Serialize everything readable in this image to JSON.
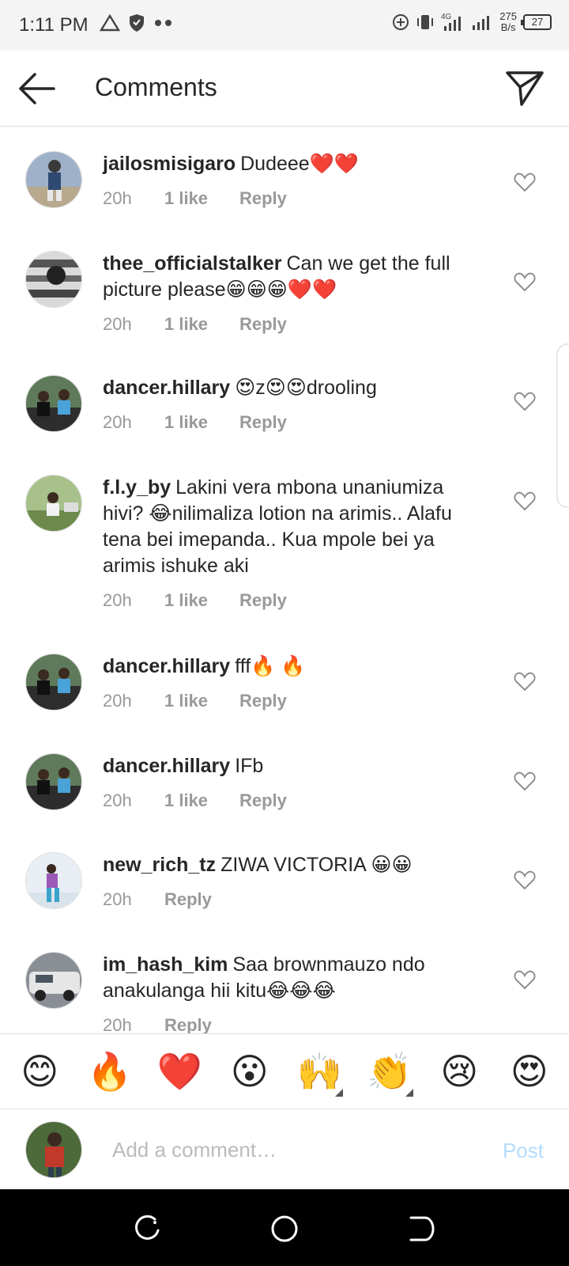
{
  "status_bar": {
    "time": "1:11 PM",
    "network": "4G",
    "speed_value": "275",
    "speed_unit": "B/s",
    "battery": "27"
  },
  "header": {
    "title": "Comments",
    "back_icon": "arrow-left-icon",
    "send_icon": "paper-plane-icon"
  },
  "comments": [
    {
      "username": "jailosmisigaro",
      "text": "Dudeee❤️❤️",
      "time": "20h",
      "likes": "1 like",
      "reply": "Reply"
    },
    {
      "username": "thee_officialstalker",
      "text": "Can we get the full picture please😁😁😁❤️❤️",
      "time": "20h",
      "likes": "1 like",
      "reply": "Reply"
    },
    {
      "username": "dancer.hillary",
      "text": "😍z😍😍drooling",
      "time": "20h",
      "likes": "1 like",
      "reply": "Reply"
    },
    {
      "username": "f.l.y_by",
      "text": "Lakini vera mbona unaniumiza hivi? 😂nilimaliza lotion na arimis.. Alafu tena bei imepanda.. Kua mpole bei ya arimis ishuke aki",
      "time": "20h",
      "likes": "1 like",
      "reply": "Reply"
    },
    {
      "username": "dancer.hillary",
      "text": "fff🔥 🔥",
      "time": "20h",
      "likes": "1 like",
      "reply": "Reply"
    },
    {
      "username": "dancer.hillary",
      "text": "IFb",
      "time": "20h",
      "likes": "1 like",
      "reply": "Reply"
    },
    {
      "username": "new_rich_tz",
      "text": "ZIWA VICTORIA 😀😀",
      "time": "20h",
      "likes": "",
      "reply": "Reply"
    },
    {
      "username": "im_hash_kim",
      "text": "Saa brownmauzo ndo anakulanga hii kitu😂😂😂",
      "time": "20h",
      "likes": "",
      "reply": "Reply"
    }
  ],
  "emoji_bar": [
    "😊",
    "🔥",
    "❤️",
    "😮",
    "🙌",
    "👏",
    "😢",
    "😍"
  ],
  "compose": {
    "placeholder": "Add a comment…",
    "post_label": "Post"
  },
  "colors": {
    "text": "#262626",
    "meta": "#999999",
    "post_disabled": "#b3dbff",
    "nav_bar": "#000000"
  }
}
